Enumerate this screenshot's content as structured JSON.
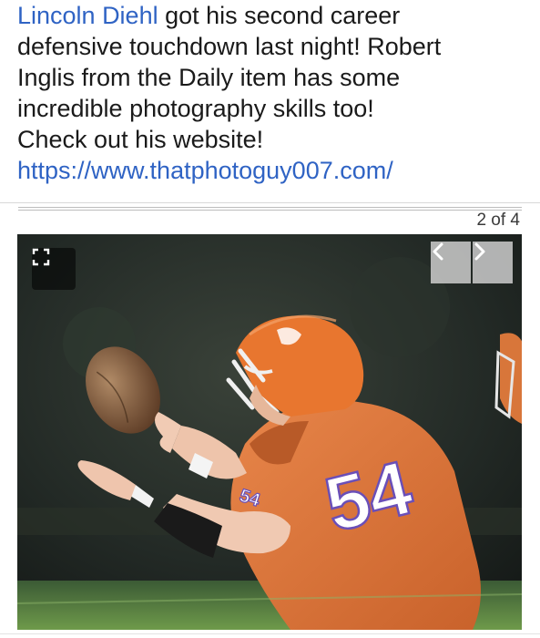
{
  "post": {
    "mention": "Lincoln Diehl",
    "line1_rest": " got his second career",
    "line2": "defensive touchdown last night! Robert",
    "line3": "Inglis from the Daily item has some",
    "line4": "incredible photography skills too!",
    "line5": "Check out his website!",
    "link": "https://www.thatphotoguy007.com/"
  },
  "gallery": {
    "counter": "2 of 4",
    "jersey_number": "54",
    "sleeve_number": "54",
    "fullscreen_icon": "expand-icon",
    "prev_icon": "chevron-left-icon",
    "next_icon": "chevron-right-icon"
  },
  "colors": {
    "link": "#2f63c4",
    "jersey": "#e07a3e",
    "helmet": "#e8762f",
    "numbers": "#ffffff"
  }
}
